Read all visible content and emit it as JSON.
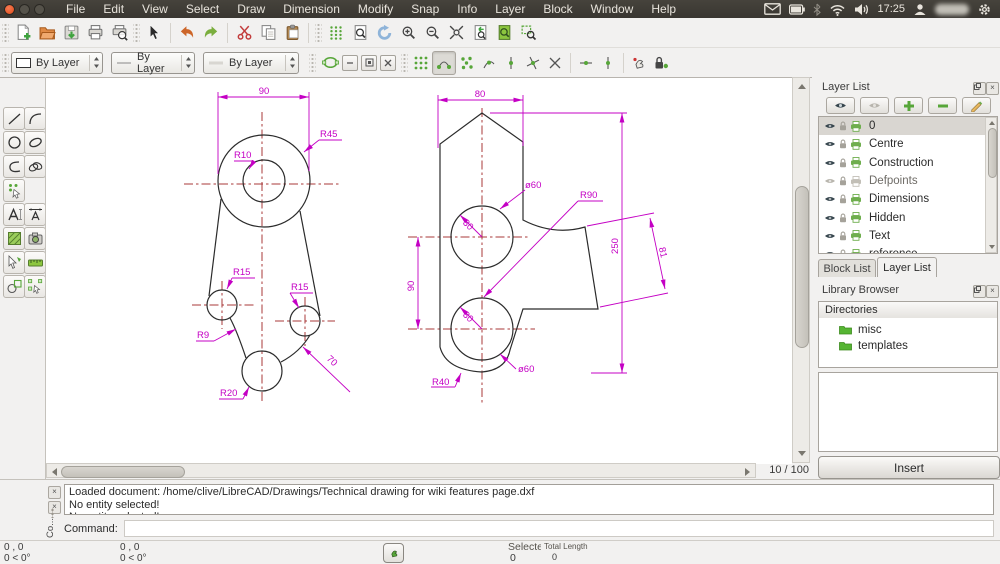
{
  "menubar": {
    "items": [
      "File",
      "Edit",
      "View",
      "Select",
      "Draw",
      "Dimension",
      "Modify",
      "Snap",
      "Info",
      "Layer",
      "Block",
      "Window",
      "Help"
    ]
  },
  "tray": {
    "clock": "17:25"
  },
  "toolbar_format": {
    "color_combo": "By Layer",
    "linetype_combo": "By Layer",
    "width_combo": "By Layer"
  },
  "canvas": {
    "page_indicator": "10 / 100"
  },
  "layer_panel": {
    "title": "Layer List",
    "layers": [
      {
        "name": "0",
        "selected": true
      },
      {
        "name": "Centre"
      },
      {
        "name": "Construction"
      },
      {
        "name": "Defpoints",
        "dimmed": true
      },
      {
        "name": "Dimensions"
      },
      {
        "name": "Hidden"
      },
      {
        "name": "Text"
      },
      {
        "name": "reference"
      }
    ]
  },
  "tabs": {
    "block_list": "Block List",
    "layer_list": "Layer List"
  },
  "library": {
    "title": "Library Browser",
    "directories_header": "Directories",
    "items": [
      "misc",
      "templates"
    ],
    "insert_label": "Insert"
  },
  "command": {
    "messages": [
      "Loaded document: /home/clive/LibreCAD/Drawings/Technical drawing for wiki features page.dxf",
      "No entity selected!",
      "No entity selected!"
    ],
    "prompt": "Command:",
    "dock_title": "Co..."
  },
  "status": {
    "abs_pos": "0 , 0",
    "abs_angle": "0 < 0°",
    "rel_pos": "0 , 0",
    "rel_angle": "0 < 0°",
    "selected_label": "Selected",
    "selected_value": "0",
    "total_length_label": "Total Length",
    "total_length_value": "0"
  },
  "drawing": {
    "left": {
      "d90": "90",
      "r45": "R45",
      "r10": "R10",
      "r15_left": "R15",
      "r15_right": "R15",
      "r9": "R9",
      "r20": "R20",
      "d70": "70"
    },
    "right": {
      "d80": "80",
      "d90": "90",
      "d250": "250",
      "d81": "81",
      "dia60_top": "ø60",
      "r90": "R90",
      "r30_top": "30",
      "r30_bottom": "30",
      "dia60_bottom": "ø60",
      "r40": "R40"
    }
  },
  "colors": {
    "dimension": "#C400C4",
    "centerline": "#A83838",
    "accent_green": "#57A639",
    "panel_dark": "#3C3933"
  }
}
